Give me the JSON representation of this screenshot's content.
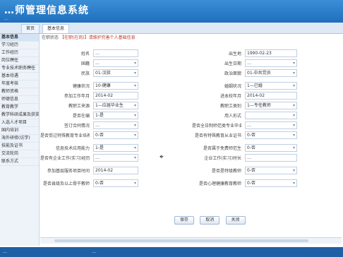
{
  "header": {
    "title": "…师管理信息系统",
    "subtitle": "…"
  },
  "tabs": [
    {
      "label": "首页"
    },
    {
      "label": "基本信息"
    }
  ],
  "sidebar": {
    "items": [
      {
        "label": "基本信息"
      },
      {
        "label": "学习经历"
      },
      {
        "label": "工作经历"
      },
      {
        "label": "岗位聘任"
      },
      {
        "label": "专业技术职务聘任"
      },
      {
        "label": "基本待遇"
      },
      {
        "label": "年度考核"
      },
      {
        "label": "教师资格"
      },
      {
        "label": "师德信息"
      },
      {
        "label": "教育教学"
      },
      {
        "label": "教学科研成果及获奖"
      },
      {
        "label": "入选人才项目"
      },
      {
        "label": "国内培训"
      },
      {
        "label": "海外研修(访学)"
      },
      {
        "label": "技能及证书"
      },
      {
        "label": "交流轮岗"
      },
      {
        "label": "联系方式"
      }
    ]
  },
  "notice": {
    "label": "在职状态",
    "text": "【在职(在岗)】请维护完善个人基础信息"
  },
  "rows": [
    {
      "l1": "姓名",
      "v1": "…",
      "l2": "出生日期",
      "v2": "1990-02-23"
    },
    {
      "l1": "国籍",
      "v1": "…",
      "l2": "出生地",
      "v2": "…"
    },
    {
      "l1": "民族",
      "v1": "01-汉族",
      "l2": "政治面貌",
      "v2": "01-中共党员"
    },
    {
      "l1": "健康状况",
      "v1": "10-健康",
      "l2": "婚姻状况",
      "v2": "1—已婚"
    },
    {
      "l1": "参加工作年月",
      "v1": "2014-02",
      "l2": "进本校年月",
      "v2": "2014-02"
    },
    {
      "l1": "教职工来源",
      "v1": "1—应届毕业生",
      "l2": "教职工类别",
      "v2": "1—专任教师"
    },
    {
      "l1": "是否在编",
      "v1": "1-是",
      "l2": "用人形式",
      "v2": ""
    },
    {
      "l1": "签订合同情况",
      "v1": "…",
      "l2": "是否全日制师范类专业毕业",
      "v2": "…"
    },
    {
      "l1": "是否受过特殊教育专业培养培训",
      "v1": "0-否",
      "l2": "是否有特殊教育从业证书",
      "v2": "0-否"
    },
    {
      "l1": "信息技术应用能力",
      "v1": "1-是",
      "l2": "是否属于免费师范生",
      "v2": "0-否"
    },
    {
      "l1": "是否有企业工作(实习)经历",
      "v1": "…",
      "l2": "企业工作(实习)时长",
      "v2": "…"
    },
    {
      "l1": "参加基层服务项目时间",
      "v1": "2014-02",
      "l2": "是否是特级教师",
      "v2": "0-否"
    },
    {
      "l1": "是否县级及以上骨干教师",
      "v1": "0-否",
      "l2": "是否心理健康教育教师",
      "v2": "0-否"
    }
  ],
  "buttons": {
    "save": "保存",
    "cancel": "取消",
    "close": "关闭"
  },
  "footer": {
    "left": "…",
    "center": "…"
  }
}
